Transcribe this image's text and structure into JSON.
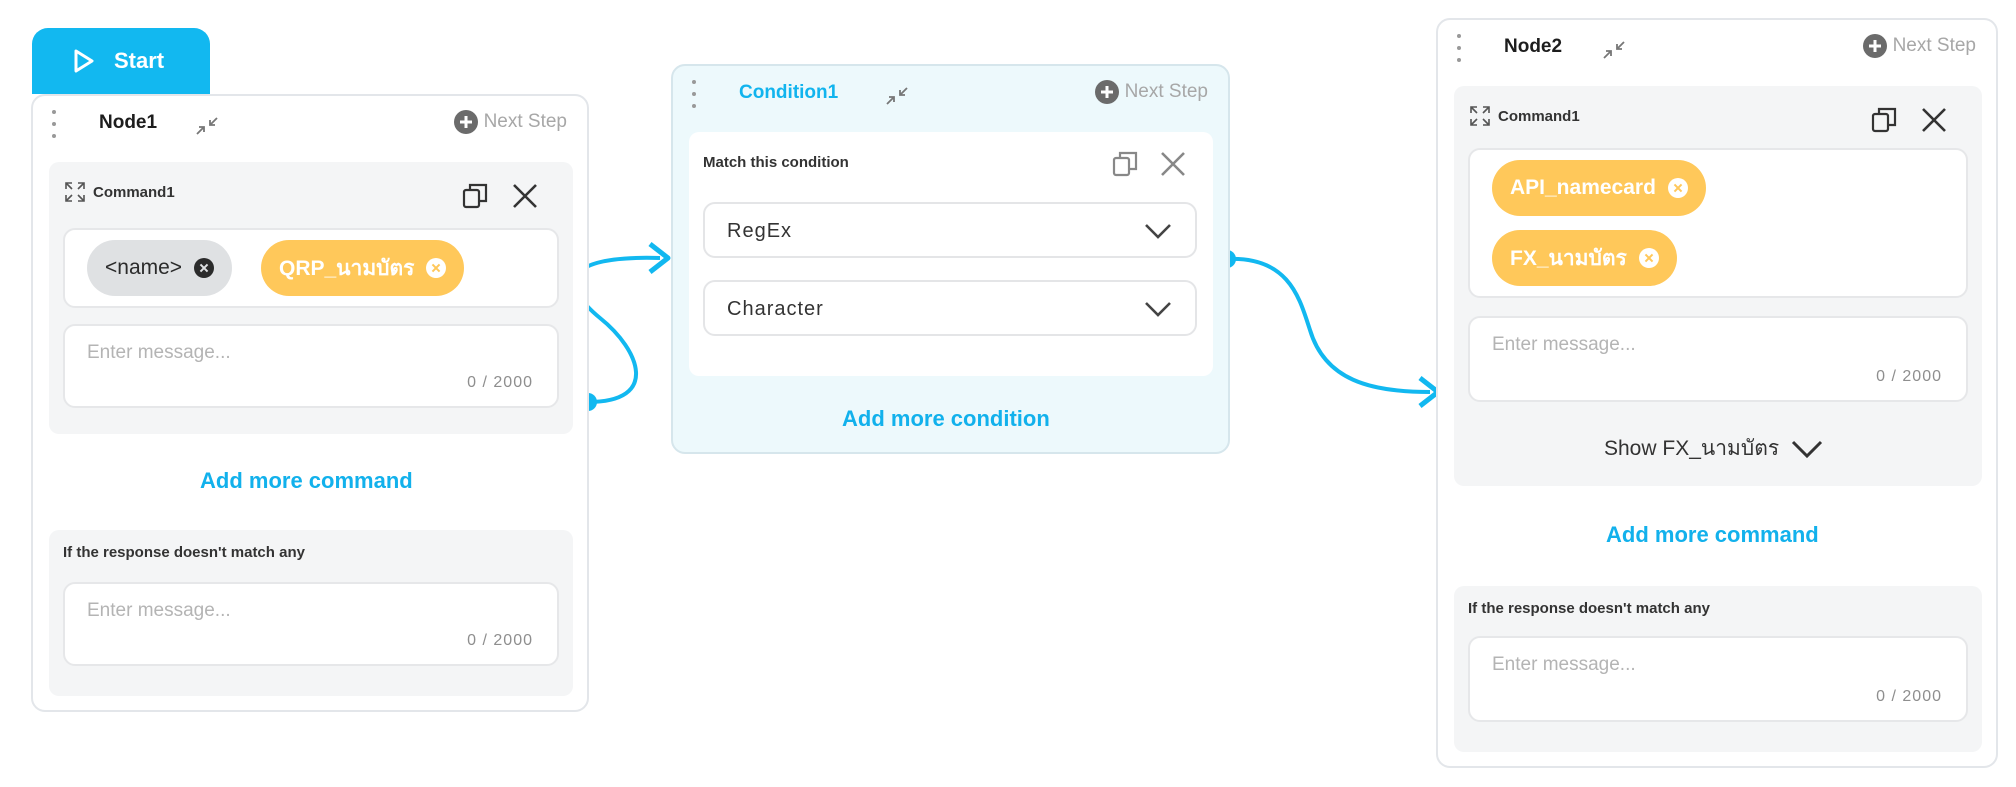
{
  "start": {
    "label": "Start"
  },
  "node1": {
    "title": "Node1",
    "next_step": "Next Step",
    "command": {
      "title": "Command1",
      "chips": [
        {
          "label": "<name>",
          "style": "grey"
        },
        {
          "label": "QRP_นามบัตร",
          "style": "yellow"
        }
      ],
      "message_placeholder": "Enter message...",
      "counter": "0 / 2000"
    },
    "add_command": "Add more command",
    "fallback": {
      "label": "If the response doesn't match any",
      "message_placeholder": "Enter message...",
      "counter": "0 / 2000"
    }
  },
  "condition1": {
    "title": "Condition1",
    "next_step": "Next Step",
    "match_label": "Match this condition",
    "selects": [
      {
        "value": "RegEx"
      },
      {
        "value": "Character"
      }
    ],
    "add_condition": "Add more condition"
  },
  "node2": {
    "title": "Node2",
    "next_step": "Next Step",
    "command": {
      "title": "Command1",
      "chips": [
        {
          "label": "API_namecard",
          "style": "yellow"
        },
        {
          "label": "FX_นามบัตร",
          "style": "yellow"
        }
      ],
      "message_placeholder": "Enter message...",
      "counter": "0 / 2000",
      "show_toggle": "Show FX_นามบัตร"
    },
    "add_command": "Add more command",
    "fallback": {
      "label": "If the response doesn't match any",
      "message_placeholder": "Enter message...",
      "counter": "0 / 2000"
    }
  },
  "colors": {
    "accent": "#12b8f0",
    "chip_yellow": "#ffc85a",
    "chip_grey": "#dfe1e3",
    "condition_bg": "#edf9fc",
    "connector": "#12b8f0"
  },
  "icons": [
    "play-icon",
    "drag-handle-icon",
    "collapse-icon",
    "plus-circle-icon",
    "expand-icon",
    "copy-icon",
    "close-icon",
    "chevron-down-icon",
    "remove-chip-icon"
  ]
}
